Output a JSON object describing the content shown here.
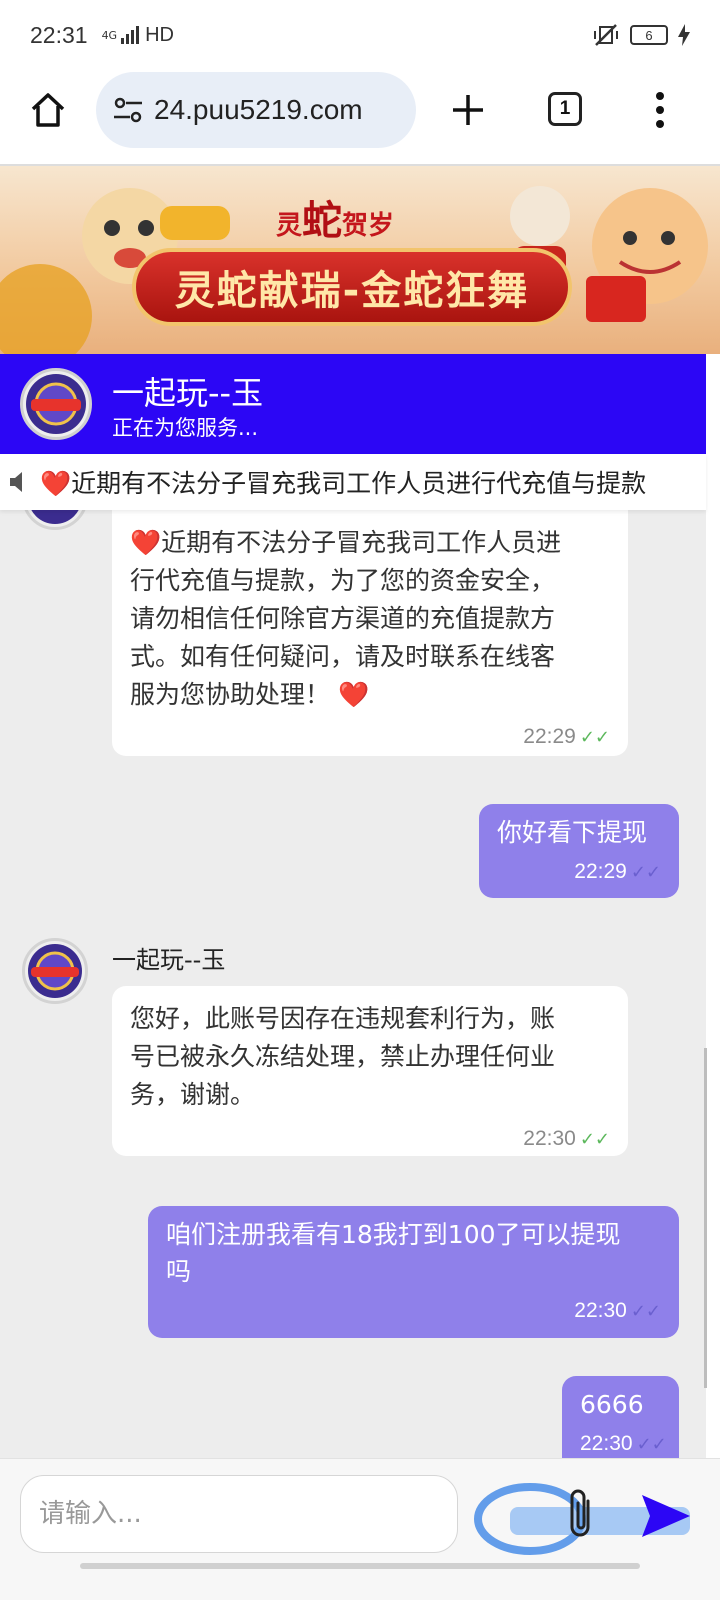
{
  "status_bar": {
    "time": "22:31",
    "network": "4G",
    "hd": "HD",
    "battery": "6"
  },
  "browser": {
    "url": "24.puu5219.com",
    "tab_count": "1"
  },
  "banner": {
    "top_text_left": "灵",
    "top_text_mid": "蛇",
    "top_text_right": "贺岁",
    "main_text": "灵蛇献瑞-金蛇狂舞"
  },
  "chat_header": {
    "name": "一起玩--玉",
    "status": "正在为您服务..."
  },
  "marquee": {
    "text": "❤️近期有不法分子冒充我司工作人员进行代充值与提款"
  },
  "messages": [
    {
      "direction": "in",
      "text": "❤️近期有不法分子冒充我司工作人员进行代充值与提款，为了您的资金安全，请勿相信任何除官方渠道的充值提款方式。如有任何疑问，请及时联系在线客服为您协助处理！❤️",
      "lines": [
        "❤️近期有不法分子冒充我司工作人员进",
        "行代充值与提款，为了您的资金安全，",
        "请勿相信任何除官方渠道的充值提款方",
        "式。如有任何疑问，请及时联系在线客",
        "服为您协助处理！ ❤️"
      ],
      "time": "22:29"
    },
    {
      "direction": "out",
      "text": "你好看下提现",
      "time": "22:29"
    },
    {
      "direction": "in",
      "sender": "一起玩--玉",
      "lines": [
        "您好，此账号因存在违规套利行为，账",
        "号已被永久冻结处理，禁止办理任何业",
        "务，谢谢。"
      ],
      "time": "22:30"
    },
    {
      "direction": "out",
      "lines": [
        "咱们注册我看有18我打到100了可以提现",
        "吗"
      ],
      "time": "22:30"
    },
    {
      "direction": "out",
      "text": "6666",
      "time": "22:30"
    }
  ],
  "input": {
    "placeholder": "请输入..."
  },
  "colors": {
    "header_bg": "#2c06f5",
    "outgoing_bubble": "#8f80ea",
    "chat_bg": "#ededed"
  },
  "icons": [
    "home-icon",
    "site-settings-icon",
    "plus-icon",
    "tabs-icon",
    "more-vert-icon",
    "speaker-icon",
    "attach-icon",
    "send-icon"
  ]
}
